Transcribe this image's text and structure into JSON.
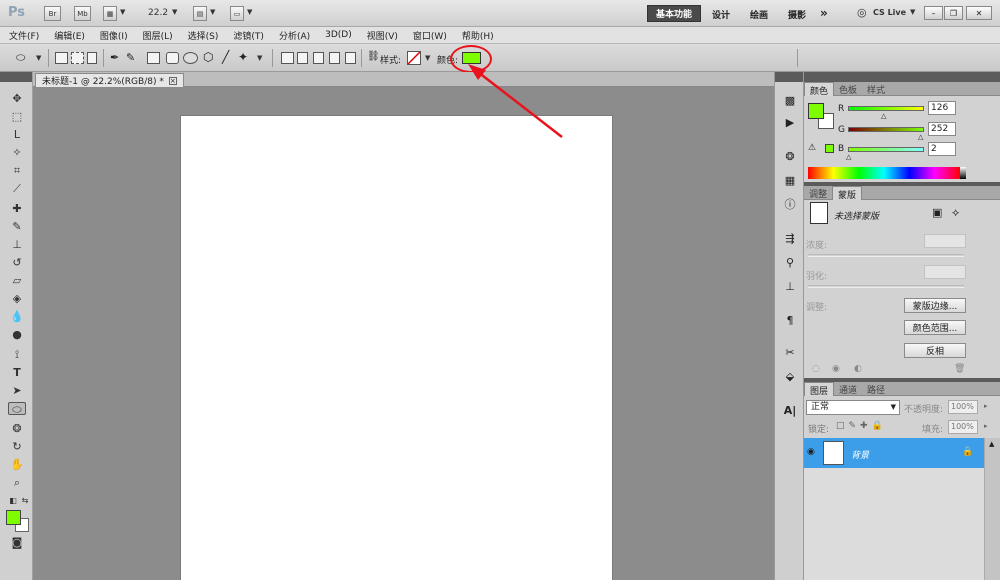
{
  "titlebar": {
    "app_logo": "Ps",
    "bridge_btn": "Br",
    "minibridge_btn": "Mb",
    "zoom": "22.2",
    "workspaces": {
      "active": "基本功能",
      "items": [
        "设计",
        "绘画",
        "摄影"
      ]
    },
    "more": "»",
    "cs_live": "CS Live"
  },
  "menu": [
    "文件(F)",
    "编辑(E)",
    "图像(I)",
    "图层(L)",
    "选择(S)",
    "滤镜(T)",
    "分析(A)",
    "3D(D)",
    "视图(V)",
    "窗口(W)",
    "帮助(H)"
  ],
  "options": {
    "style_label": "样式:",
    "color_label": "颜色:",
    "fill_color": "#7efc02"
  },
  "document": {
    "tab_title": "未标题-1 @ 22.2%(RGB/8) *"
  },
  "color_panel": {
    "tabs": [
      "颜色",
      "色板",
      "样式"
    ],
    "foreground": "#7efc02",
    "r_label": "R",
    "g_label": "G",
    "b_label": "B",
    "r": "126",
    "g": "252",
    "b": "2"
  },
  "masks_panel": {
    "tabs": [
      "调整",
      "蒙版"
    ],
    "no_mask": "未选择蒙版",
    "density": "浓度:",
    "feather": "羽化:",
    "refine": "调整:",
    "edge_btn": "蒙版边缘...",
    "range_btn": "颜色范围...",
    "invert_btn": "反相"
  },
  "layers_panel": {
    "tabs": [
      "图层",
      "通道",
      "路径"
    ],
    "blend_mode": "正常",
    "opacity_label": "不透明度:",
    "opacity": "100%",
    "lock_label": "锁定:",
    "fill_label": "填充:",
    "fill": "100%",
    "layer_name": "背景"
  },
  "accent_red": "#e8131d"
}
